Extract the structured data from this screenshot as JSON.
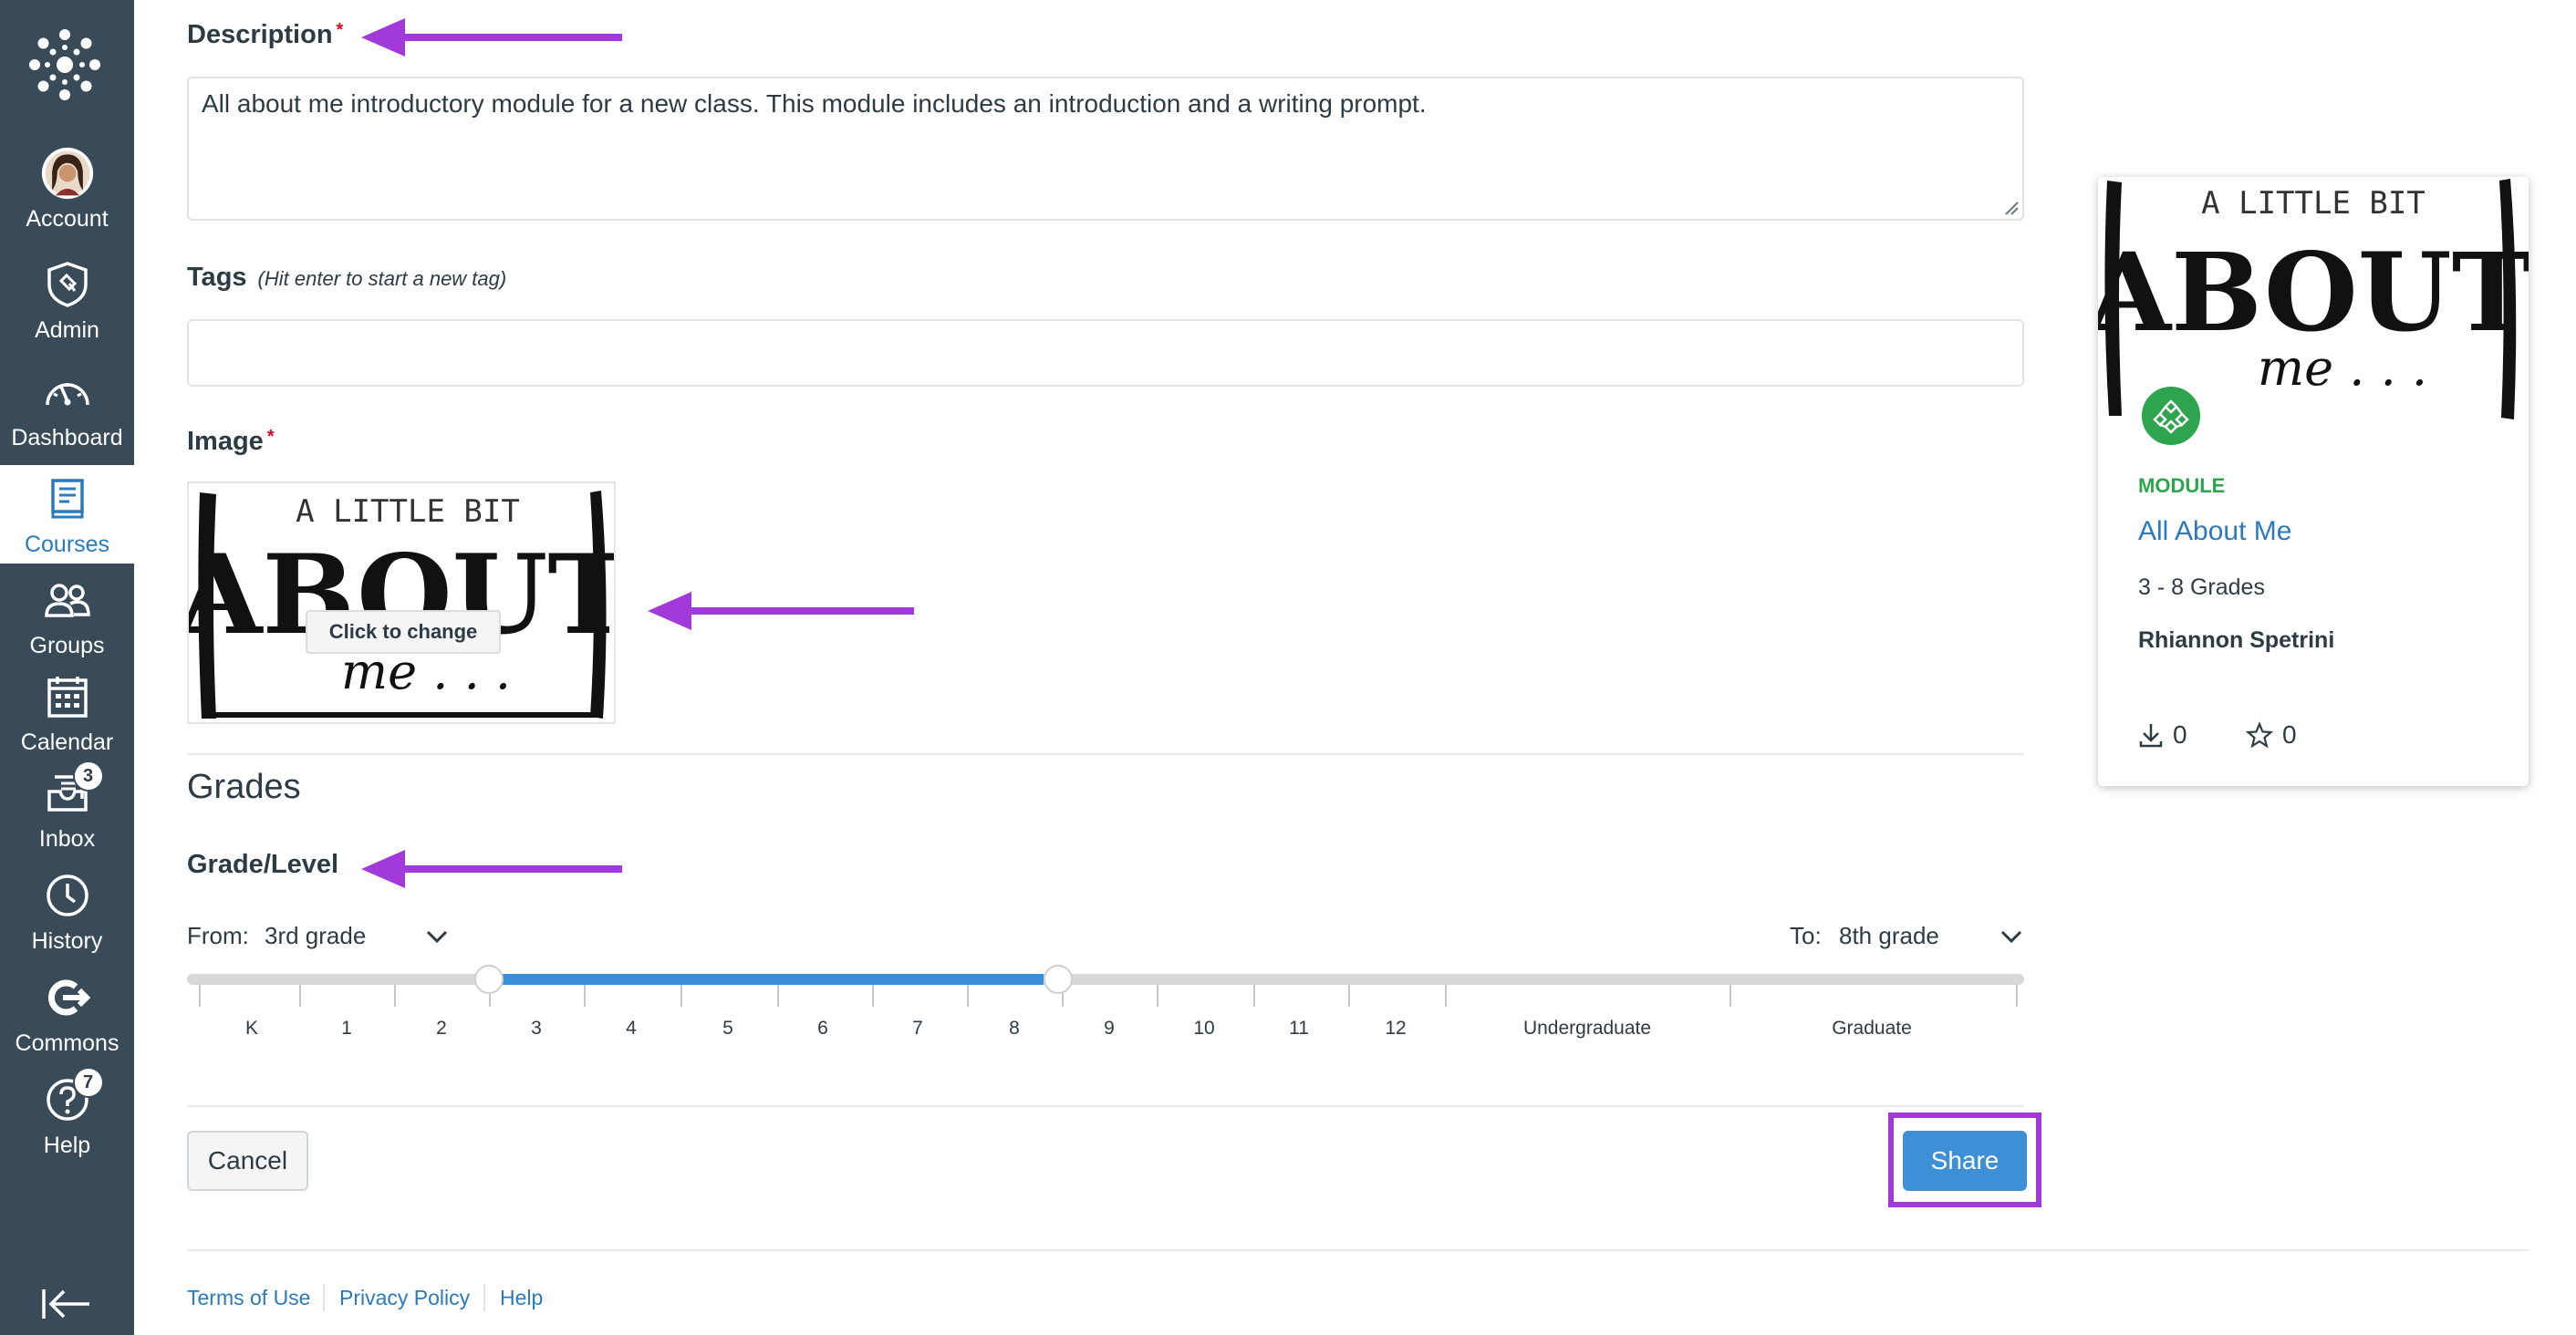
{
  "sidebar": {
    "items": [
      {
        "label": "Account",
        "icon": "avatar-icon"
      },
      {
        "label": "Admin",
        "icon": "shield-icon"
      },
      {
        "label": "Dashboard",
        "icon": "speedometer-icon"
      },
      {
        "label": "Courses",
        "icon": "book-icon"
      },
      {
        "label": "Groups",
        "icon": "people-icon"
      },
      {
        "label": "Calendar",
        "icon": "calendar-icon"
      },
      {
        "label": "Inbox",
        "icon": "inbox-icon",
        "badge": "3"
      },
      {
        "label": "History",
        "icon": "clock-icon"
      },
      {
        "label": "Commons",
        "icon": "commons-icon"
      },
      {
        "label": "Help",
        "icon": "help-icon",
        "badge": "7"
      }
    ]
  },
  "form": {
    "description_label": "Description",
    "description_value": "All about me introductory module for a new class. This module includes an introduction and a writing prompt.",
    "tags_label": "Tags",
    "tags_hint": "(Hit enter to start a new tag)",
    "tags_value": "",
    "image_label": "Image",
    "image_button": "Click to change",
    "required_mark": "*",
    "grades_heading": "Grades",
    "grade_level_label": "Grade/Level",
    "from_label": "From:",
    "from_value": "3rd grade",
    "to_label": "To:",
    "to_value": "8th grade",
    "scale": [
      "K",
      "1",
      "2",
      "3",
      "4",
      "5",
      "6",
      "7",
      "8",
      "9",
      "10",
      "11",
      "12",
      "Undergraduate",
      "Graduate"
    ],
    "cancel_label": "Cancel",
    "share_label": "Share"
  },
  "image_art": {
    "line1": "A  LITTLE  BIT",
    "line2": "ABOUT",
    "line3": "me . . ."
  },
  "footer": {
    "links": [
      "Terms of Use",
      "Privacy Policy",
      "Help"
    ]
  },
  "card": {
    "type": "MODULE",
    "title": "All About Me",
    "grades": "3 - 8 Grades",
    "author": "Rhiannon Spetrini",
    "downloads": "0",
    "favorites": "0"
  },
  "colors": {
    "sidebar_bg": "#394b58",
    "accent_blue": "#3d8fd6",
    "link_blue": "#2b7abc",
    "annotation_purple": "#a23ad9",
    "module_green": "#2ea44f"
  }
}
